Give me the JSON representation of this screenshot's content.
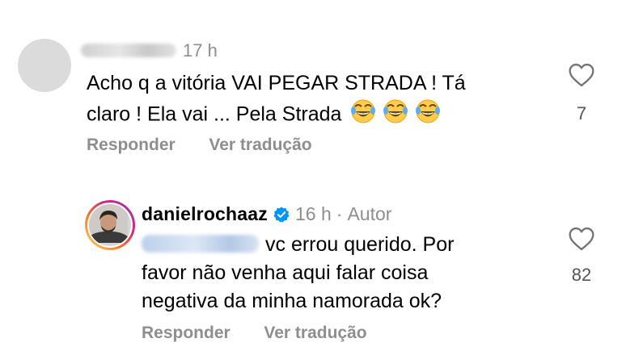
{
  "comment1": {
    "time": "17 h",
    "text_line1": "Acho q a vitória VAI PEGAR STRADA ! Tá",
    "text_line2": "claro ! Ela vai ... Pela Strada",
    "emoji": "😂😂😂",
    "reply_label": "Responder",
    "translate_label": "Ver tradução",
    "likes": "7"
  },
  "comment2": {
    "username": "danielrochaaz",
    "time": "16 h",
    "separator": "·",
    "author_tag": "Autor",
    "text_line1": "vc errou querido. Por",
    "text_line2": "favor não venha aqui falar coisa",
    "text_line3": "negativa da minha namorada ok?",
    "reply_label": "Responder",
    "translate_label": "Ver tradução",
    "likes": "82"
  },
  "icons": {
    "heart": "heart-icon",
    "verified": "verified-badge-icon",
    "emoji": "face-with-tears-of-joy"
  },
  "colors": {
    "verified_blue": "#0095f6",
    "meta_gray": "#8e8e8e",
    "mention_blue": "#00376b"
  }
}
